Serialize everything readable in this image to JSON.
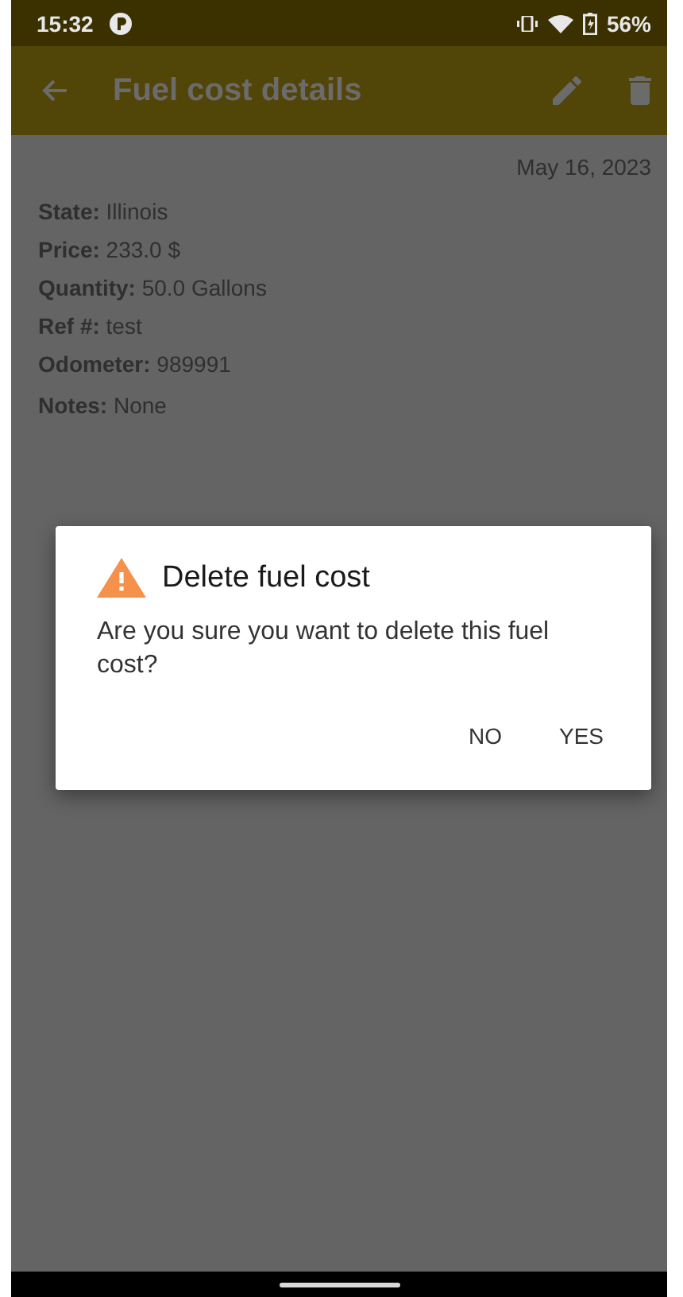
{
  "status_bar": {
    "time": "15:32",
    "battery": "56%"
  },
  "toolbar": {
    "title": "Fuel cost details"
  },
  "details": {
    "date": "May 16, 2023",
    "fields": [
      {
        "text": "**State:** Illinois"
      },
      {
        "text": "**Price:** 233.0 $"
      },
      {
        "text": "**Quantity:** 50.0 Gallons"
      },
      {
        "text": "**Ref #:** test"
      },
      {
        "text": "**Odometer:** 989991"
      },
      {
        "text": "**Notes:** None"
      }
    ]
  },
  "dialog": {
    "title": "Delete fuel cost",
    "message": "Are you sure you want to delete this fuel cost?",
    "buttons": [
      "NO",
      "YES"
    ]
  }
}
